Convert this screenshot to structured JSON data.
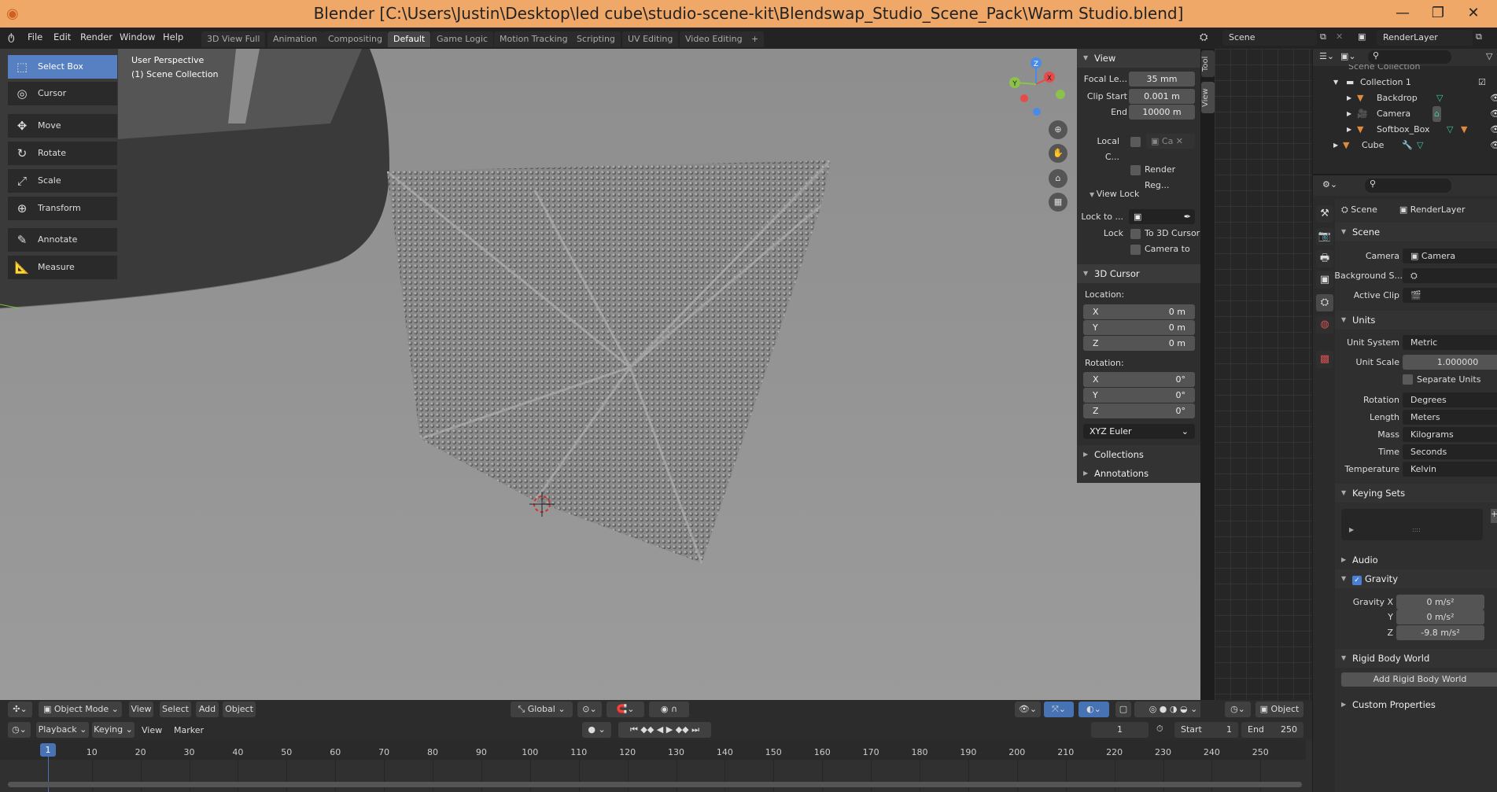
{
  "title": "Blender [C:\\Users\\Justin\\Desktop\\led cube\\studio-scene-kit\\Blendswap_Studio_Scene_Pack\\Warm Studio.blend]",
  "menu": [
    "File",
    "Edit",
    "Render",
    "Window",
    "Help"
  ],
  "workspaces": [
    "3D View Full",
    "Animation",
    "Compositing",
    "Default",
    "Game Logic",
    "Motion Tracking",
    "Scripting",
    "UV Editing",
    "Video Editing",
    "+"
  ],
  "active_workspace": "Default",
  "scene_selector": "Scene",
  "layer_selector": "RenderLayer",
  "viewport": {
    "perspective": "User Perspective",
    "collection": "(1) Scene Collection",
    "gizmo_axes": [
      "X",
      "Y",
      "Z"
    ]
  },
  "tools": [
    "Select Box",
    "Cursor",
    "Move",
    "Rotate",
    "Scale",
    "Transform",
    "Annotate",
    "Measure"
  ],
  "npanel": {
    "tabs": [
      "Tool",
      "View"
    ],
    "view_header": "View",
    "focal_label": "Focal Le...",
    "focal": "35 mm",
    "clip_start_label": "Clip Start",
    "clip_start": "0.001 m",
    "end_label": "End",
    "end": "10000 m",
    "local_camera_label": "Local C...",
    "local_camera_value": "Ca",
    "render_region": "Render Reg...",
    "view_lock_header": "View Lock",
    "lock_to_label": "Lock to ...",
    "lock_label": "Lock",
    "to_3d_cursor": "To 3D Cursor",
    "camera_to": "Camera to ...",
    "cursor_header": "3D Cursor",
    "location_label": "Location:",
    "location": [
      {
        "axis": "X",
        "value": "0 m"
      },
      {
        "axis": "Y",
        "value": "0 m"
      },
      {
        "axis": "Z",
        "value": "0 m"
      }
    ],
    "rotation_label": "Rotation:",
    "rotation": [
      {
        "axis": "X",
        "value": "0°"
      },
      {
        "axis": "Y",
        "value": "0°"
      },
      {
        "axis": "Z",
        "value": "0°"
      }
    ],
    "rotation_mode": "XYZ Euler",
    "collections": "Collections",
    "annotations": "Annotations"
  },
  "outliner": {
    "partial_row": "Scene Collection",
    "items": [
      {
        "name": "Collection 1",
        "indent": 0
      },
      {
        "name": "Backdrop",
        "indent": 1
      },
      {
        "name": "Camera",
        "indent": 1
      },
      {
        "name": "Softbox_Box",
        "indent": 1
      },
      {
        "name": "Cube",
        "indent": 0
      }
    ]
  },
  "properties": {
    "breadcrumb": [
      "Scene",
      "RenderLayer"
    ],
    "scene_header": "Scene",
    "camera_label": "Camera",
    "camera": "Camera",
    "background_label": "Background S...",
    "active_clip_label": "Active Clip",
    "units_header": "Units",
    "unit_system_label": "Unit System",
    "unit_system": "Metric",
    "unit_scale_label": "Unit Scale",
    "unit_scale": "1.000000",
    "separate_units": "Separate Units",
    "rotation_label": "Rotation",
    "rotation": "Degrees",
    "length_label": "Length",
    "length": "Meters",
    "mass_label": "Mass",
    "mass": "Kilograms",
    "time_label": "Time",
    "time": "Seconds",
    "temperature_label": "Temperature",
    "temperature": "Kelvin",
    "keying_sets": "Keying Sets",
    "audio": "Audio",
    "gravity": "Gravity",
    "gravity_enabled": true,
    "gravity_x_label": "Gravity X",
    "gravity_x": "0 m/s²",
    "gravity_y_label": "Y",
    "gravity_y": "0 m/s²",
    "gravity_z_label": "Z",
    "gravity_z": "-9.8 m/s²",
    "rigid_body_world": "Rigid Body World",
    "add_rigid_body_world": "Add Rigid Body World",
    "custom_properties": "Custom Properties"
  },
  "viewport_header": {
    "mode": "Object Mode",
    "menus": [
      "View",
      "Select",
      "Add",
      "Object"
    ],
    "orientation": "Global",
    "context": "Object"
  },
  "timeline": {
    "menus": [
      "Playback",
      "Keying",
      "View",
      "Marker"
    ],
    "current_frame": "1",
    "start_label": "Start",
    "start": "1",
    "end_label": "End",
    "end": "250",
    "ticks": [
      "10",
      "20",
      "30",
      "40",
      "50",
      "60",
      "70",
      "80",
      "90",
      "100",
      "110",
      "120",
      "130",
      "140",
      "150",
      "160",
      "170",
      "180",
      "190",
      "200",
      "210",
      "220",
      "230",
      "240",
      "250"
    ]
  },
  "colors": {
    "accent": "#5680c2",
    "titlebar": "#f0a868",
    "object_orange": "#e08a3c",
    "mesh_green": "#3cc8a0"
  }
}
